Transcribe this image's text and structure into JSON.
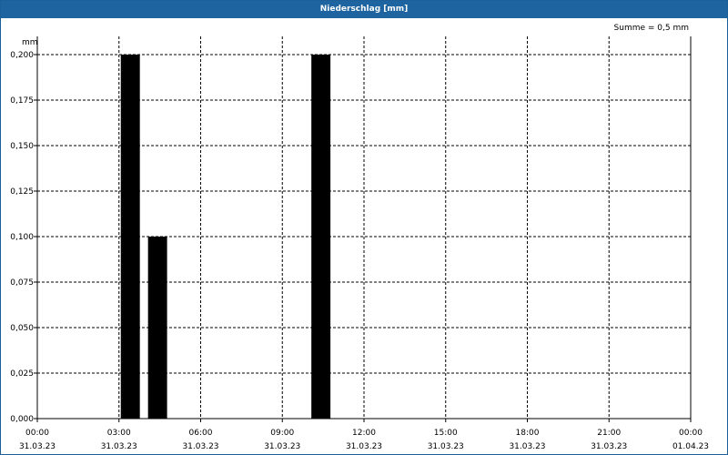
{
  "window": {
    "title": "Niederschlag [mm]"
  },
  "summary": {
    "text": "Summe = 0,5 mm"
  },
  "colors": {
    "title_bar": "#1e64a0",
    "bar_fill": "#000000",
    "grid": "#000000"
  },
  "chart_data": {
    "type": "bar",
    "title": "Niederschlag [mm]",
    "ylabel": "mm",
    "xlabel": "",
    "ylim": [
      0,
      0.2
    ],
    "yticks": [
      "0,000",
      "0,025",
      "0,050",
      "0,075",
      "0,100",
      "0,125",
      "0,150",
      "0,175",
      "0,200"
    ],
    "xlim_hours": [
      0,
      24
    ],
    "xticks": [
      {
        "time": "00:00",
        "date": "31.03.23"
      },
      {
        "time": "03:00",
        "date": "31.03.23"
      },
      {
        "time": "06:00",
        "date": "31.03.23"
      },
      {
        "time": "09:00",
        "date": "31.03.23"
      },
      {
        "time": "12:00",
        "date": "31.03.23"
      },
      {
        "time": "15:00",
        "date": "31.03.23"
      },
      {
        "time": "18:00",
        "date": "31.03.23"
      },
      {
        "time": "21:00",
        "date": "31.03.23"
      },
      {
        "time": "00:00",
        "date": "01.04.23"
      }
    ],
    "grid": true,
    "bars": [
      {
        "start": "03:00",
        "end": "04:00",
        "value": 0.2
      },
      {
        "start": "04:00",
        "end": "05:00",
        "value": 0.1
      },
      {
        "start": "10:00",
        "end": "11:00",
        "value": 0.2
      }
    ]
  }
}
